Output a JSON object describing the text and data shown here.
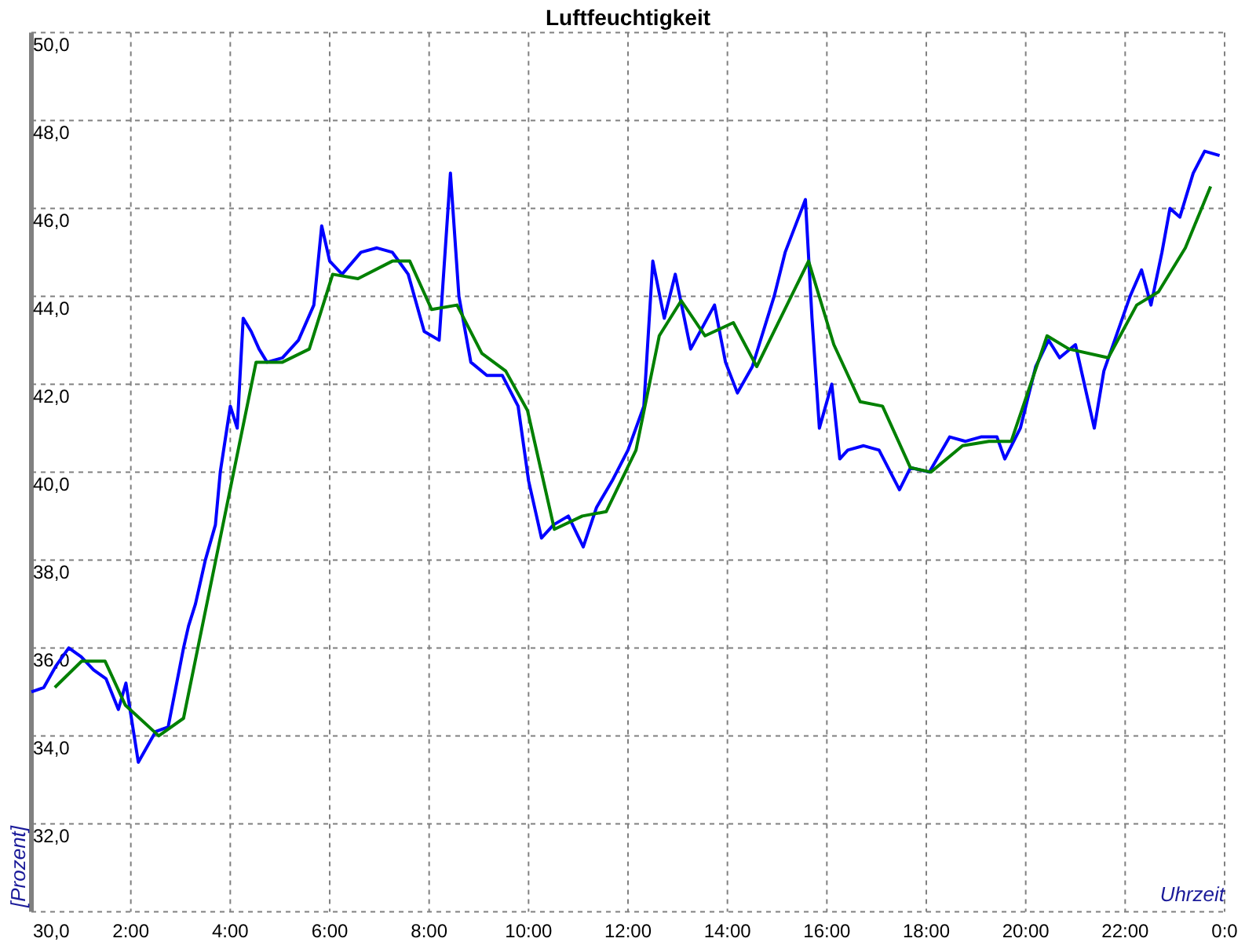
{
  "chart": {
    "chart_data": {
      "type": "line",
      "grid": true,
      "title": "Luftfeuchtigkeit",
      "xlabel": "Uhrzeit",
      "ylabel": "[Prozent]",
      "xlim": [
        0,
        24
      ],
      "ylim": [
        30,
        50
      ],
      "xticks": [
        {
          "value": 2,
          "label": "2:00"
        },
        {
          "value": 4,
          "label": "4:00"
        },
        {
          "value": 6,
          "label": "6:00"
        },
        {
          "value": 8,
          "label": "8:00"
        },
        {
          "value": 10,
          "label": "10:00"
        },
        {
          "value": 12,
          "label": "12:00"
        },
        {
          "value": 14,
          "label": "14:00"
        },
        {
          "value": 16,
          "label": "16:00"
        },
        {
          "value": 18,
          "label": "18:00"
        },
        {
          "value": 20,
          "label": "20:00"
        },
        {
          "value": 22,
          "label": "22:00"
        },
        {
          "value": 24,
          "label": "0:0"
        }
      ],
      "yticks": [
        {
          "value": 30,
          "label": "30,0"
        },
        {
          "value": 32,
          "label": "32,0"
        },
        {
          "value": 34,
          "label": "34,0"
        },
        {
          "value": 36,
          "label": "36,0"
        },
        {
          "value": 38,
          "label": "38,0"
        },
        {
          "value": 40,
          "label": "40,0"
        },
        {
          "value": 42,
          "label": "42,0"
        },
        {
          "value": 44,
          "label": "44,0"
        },
        {
          "value": 46,
          "label": "46,0"
        },
        {
          "value": 48,
          "label": "48,0"
        },
        {
          "value": 50,
          "label": "50,0"
        }
      ],
      "series": [
        {
          "color": "#0000ff",
          "x": [
            0,
            0.25,
            0.5,
            0.75,
            1.0,
            1.25,
            1.5,
            1.75,
            1.9,
            2.15,
            2.5,
            2.75,
            3.06,
            3.16,
            3.3,
            3.5,
            3.7,
            3.8,
            4.0,
            4.14,
            4.26,
            4.42,
            4.58,
            4.74,
            5.05,
            5.37,
            5.68,
            5.84,
            6.0,
            6.25,
            6.63,
            6.95,
            7.26,
            7.58,
            7.9,
            8.2,
            8.43,
            8.6,
            8.84,
            9.16,
            9.47,
            9.79,
            10.0,
            10.26,
            10.5,
            10.8,
            11.1,
            11.37,
            11.68,
            12.0,
            12.32,
            12.5,
            12.73,
            12.95,
            13.26,
            13.74,
            13.96,
            14.2,
            14.5,
            14.94,
            15.16,
            15.57,
            15.7,
            15.85,
            16.1,
            16.26,
            16.42,
            16.74,
            17.05,
            17.46,
            17.68,
            18.06,
            18.47,
            18.79,
            19.1,
            19.42,
            19.58,
            19.89,
            20.2,
            20.46,
            20.68,
            21.0,
            21.38,
            21.57,
            21.79,
            22.1,
            22.33,
            22.52,
            22.74,
            22.9,
            23.1,
            23.37,
            23.6,
            23.9
          ],
          "values": [
            35.0,
            35.1,
            35.6,
            36.0,
            35.8,
            35.5,
            35.3,
            34.6,
            35.2,
            33.4,
            34.1,
            34.2,
            36.0,
            36.5,
            37.0,
            38.0,
            38.8,
            40.0,
            41.5,
            41.0,
            43.5,
            43.2,
            42.8,
            42.5,
            42.6,
            43.0,
            43.8,
            45.6,
            44.8,
            44.5,
            45.0,
            45.1,
            45.0,
            44.5,
            43.2,
            43.0,
            46.8,
            44.0,
            42.5,
            42.2,
            42.2,
            41.5,
            39.8,
            38.5,
            38.8,
            39.0,
            38.3,
            39.2,
            39.8,
            40.5,
            41.5,
            44.8,
            43.5,
            44.5,
            42.8,
            43.8,
            42.5,
            41.8,
            42.4,
            44.0,
            45.0,
            46.2,
            43.5,
            41.0,
            42.0,
            40.3,
            40.5,
            40.6,
            40.5,
            39.6,
            40.1,
            40.0,
            40.8,
            40.7,
            40.8,
            40.8,
            40.3,
            41.0,
            42.4,
            43.0,
            42.6,
            42.9,
            41.0,
            42.3,
            43.0,
            44.0,
            44.6,
            43.8,
            45.0,
            46.0,
            45.8,
            46.8,
            47.3,
            47.2
          ]
        },
        {
          "color": "#008000",
          "x": [
            0.47,
            1.01,
            1.48,
            1.89,
            2.56,
            3.06,
            4.52,
            5.05,
            5.59,
            6.06,
            6.57,
            7.26,
            7.61,
            8.05,
            8.56,
            9.06,
            9.54,
            9.98,
            10.52,
            11.08,
            11.56,
            12.16,
            12.63,
            13.07,
            13.55,
            14.12,
            14.59,
            15.63,
            16.14,
            16.67,
            17.12,
            17.68,
            18.09,
            18.73,
            19.26,
            19.71,
            20.43,
            20.87,
            21.66,
            22.23,
            22.67,
            23.21,
            23.72
          ],
          "values": [
            35.1,
            35.7,
            35.7,
            34.7,
            34.0,
            34.4,
            42.5,
            42.5,
            42.8,
            44.5,
            44.4,
            44.8,
            44.8,
            43.7,
            43.8,
            42.7,
            42.3,
            41.4,
            38.7,
            39.0,
            39.1,
            40.5,
            43.1,
            43.9,
            43.1,
            43.4,
            42.4,
            44.8,
            42.9,
            41.6,
            41.5,
            40.1,
            40.0,
            40.6,
            40.7,
            40.7,
            43.1,
            42.8,
            42.6,
            43.8,
            44.1,
            45.1,
            46.5
          ]
        }
      ]
    }
  }
}
